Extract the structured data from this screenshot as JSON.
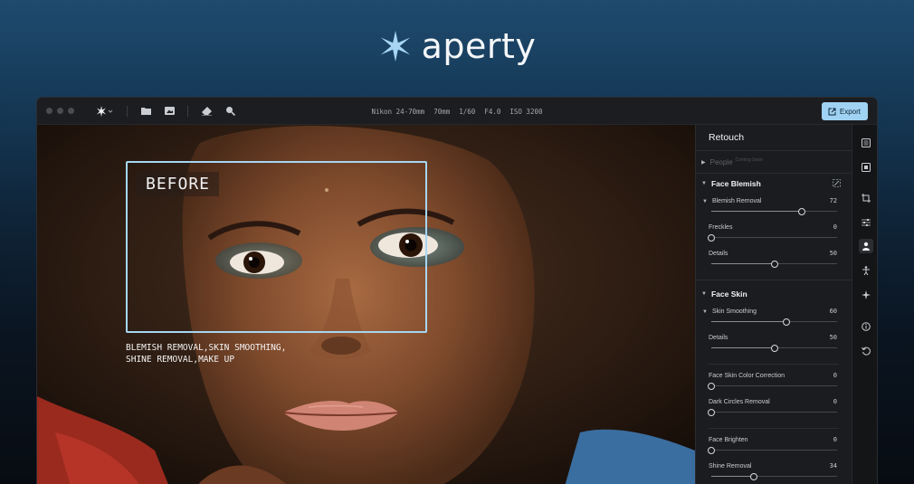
{
  "brand": {
    "name": "aperty",
    "logo_icon": "star-logo-icon",
    "accent": "#9fd2f3"
  },
  "titlebar": {
    "exif": [
      "Nikon 24-70mm",
      "70mm",
      "1/60",
      "F4.0",
      "ISO 3200"
    ],
    "export_label": "Export",
    "icons": [
      "app-menu-icon",
      "folder-icon",
      "gallery-icon",
      "eraser-icon",
      "magnifier-icon"
    ]
  },
  "canvas": {
    "before_label": "BEFORE",
    "caption": "BLEMISH REMOVAL,SKIN SMOOTHING,\nSHINE REMOVAL,MAKE UP"
  },
  "panel": {
    "title": "Retouch",
    "people": {
      "label": "People",
      "badge": "Coming Soon"
    },
    "face_blemish": {
      "title": "Face Blemish",
      "sliders": [
        {
          "label": "Blemish Removal",
          "value": "72",
          "level": 0.72,
          "expandable": true
        },
        {
          "label": "Freckles",
          "value": "0",
          "level": 0
        },
        {
          "label": "Details",
          "value": "50",
          "level": 0.5
        }
      ]
    },
    "face_skin": {
      "title": "Face Skin",
      "sliders": [
        {
          "label": "Skin Smoothing",
          "value": "60",
          "level": 0.6,
          "expandable": true
        },
        {
          "label": "Details",
          "value": "50",
          "level": 0.5
        },
        {
          "label": "Face Skin Color Correction",
          "value": "0",
          "level": 0
        },
        {
          "label": "Dark Circles Removal",
          "value": "0",
          "level": 0
        },
        {
          "label": "Face Brighten",
          "value": "0",
          "level": 0
        },
        {
          "label": "Shine Removal",
          "value": "34",
          "level": 0.34
        }
      ]
    }
  },
  "toolrail": [
    "library-icon",
    "select-icon",
    "crop-icon",
    "adjust-icon",
    "person-icon",
    "body-icon",
    "sparkle-icon",
    "info-icon",
    "history-icon"
  ]
}
